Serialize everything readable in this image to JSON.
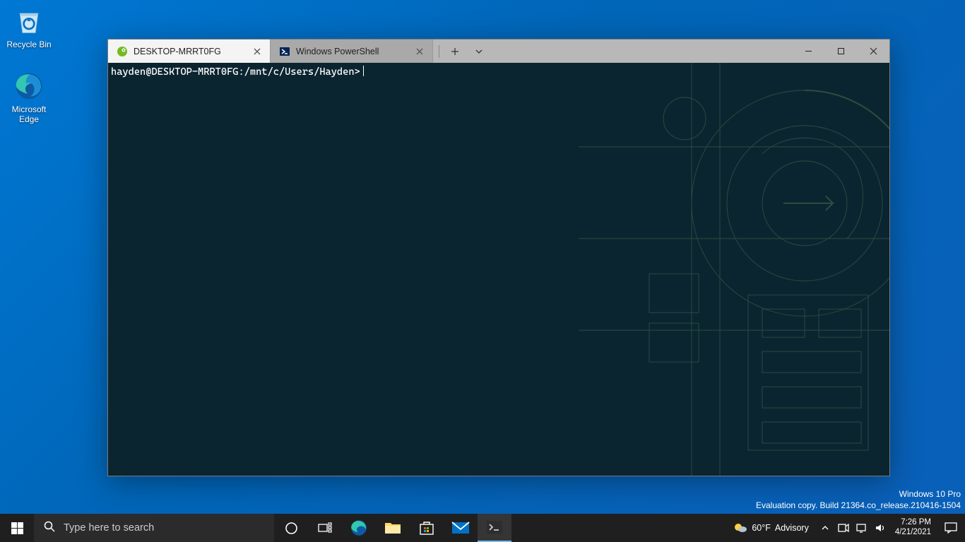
{
  "desktop": {
    "icons": [
      {
        "name": "recycle-bin",
        "label": "Recycle Bin"
      },
      {
        "name": "microsoft-edge",
        "label": "Microsoft\nEdge"
      }
    ]
  },
  "watermark": {
    "line1": "Windows 10 Pro",
    "line2": "Evaluation copy. Build 21364.co_release.210416-1504"
  },
  "terminal": {
    "tabs": [
      {
        "label": "DESKTOP-MRRT0FG",
        "active": true,
        "icon": "opensuse"
      },
      {
        "label": "Windows PowerShell",
        "active": false,
        "icon": "powershell"
      }
    ],
    "prompt": "hayden@DESKTOP-MRRT0FG:/mnt/c/Users/Hayden>"
  },
  "taskbar": {
    "search_placeholder": "Type here to search",
    "weather_temp": "60°F",
    "weather_cond": "Advisory",
    "time": "7:26 PM",
    "date": "4/21/2021"
  }
}
